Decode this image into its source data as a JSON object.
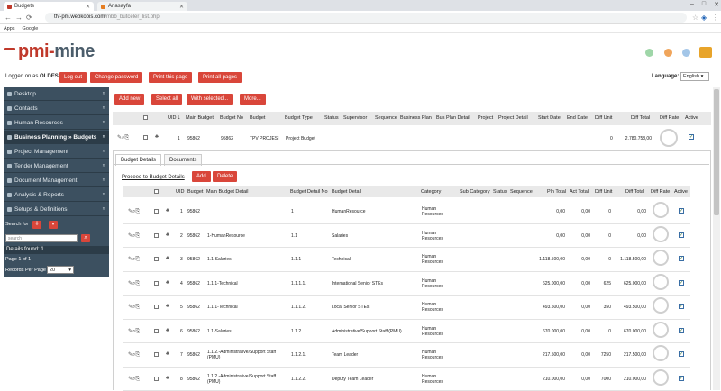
{
  "browser": {
    "tabs": [
      {
        "title": "Budgets",
        "active": true
      },
      {
        "title": "Anasayfa",
        "active": false
      }
    ],
    "address_host": "tfv-pm.webkobis.com",
    "address_path": "/mbb_butceler_list.php",
    "bookmarks": [
      "Apps",
      "Google"
    ]
  },
  "header": {
    "logo_prefix": "pmi-",
    "logo_suffix": "mine",
    "logged_prefix": "Logged on as",
    "logged_user": "OLDES",
    "buttons": [
      "Log out",
      "Change password",
      "Print this page",
      "Print all pages"
    ],
    "language_label": "Language:",
    "language_value": "English"
  },
  "sidebar": {
    "items": [
      {
        "label": "Desktop",
        "active": false
      },
      {
        "label": "Contacts",
        "active": false
      },
      {
        "label": "Human Resources",
        "active": false
      },
      {
        "label": "Business Planning » Budgets",
        "active": true
      },
      {
        "label": "Project Management",
        "active": false
      },
      {
        "label": "Tender Management",
        "active": false
      },
      {
        "label": "Document Management",
        "active": false
      },
      {
        "label": "Analysis & Reports",
        "active": false
      },
      {
        "label": "Setups & Definitions",
        "active": false
      }
    ],
    "search_for": "Search for",
    "search_placeholder": "search",
    "details_found": "Details found",
    "details_count": "1",
    "page_of": "Page 1 of 1",
    "records_per_page": "Records Per Page",
    "records_value": "20"
  },
  "toolbar": {
    "buttons": [
      "Add new",
      "Select all",
      "With selected...",
      "More..."
    ]
  },
  "budget_table": {
    "columns": [
      "UID",
      "Main Budget",
      "Budget No",
      "Budget",
      "Budget Type",
      "Status",
      "Supervisor",
      "Sequence",
      "Business Plan",
      "Bus Plan Detail",
      "Project",
      "Project Detail",
      "Start Date",
      "End Date",
      "Diff Unit",
      "Diff Total",
      "Diff Rate",
      "Active"
    ],
    "row": {
      "uid": "1",
      "main_budget": "95862",
      "budget_no": "95862",
      "budget": "TPV PROJESI",
      "budget_type": "Project Budget",
      "diff_unit": "0",
      "diff_total": "2.780.758,00"
    }
  },
  "detail_tabs": [
    "Budget Details",
    "Documents"
  ],
  "detail_buttons": [
    "Add",
    "Delete"
  ],
  "proceed_link": "Proceed to Budget Details",
  "detail_table": {
    "columns": [
      "UID",
      "Budget",
      "Main Budget Detail",
      "Budget Detail No",
      "Budget Detail",
      "Category",
      "Sub Category",
      "Status",
      "Sequence",
      "Pln Total",
      "Act Total",
      "Diff Unit",
      "Diff Total",
      "Diff Rate",
      "Active"
    ],
    "rows": [
      {
        "uid": "1",
        "budget": "95862",
        "main_detail": "",
        "detail_no": "1",
        "detail": "HumanResource",
        "category": "Human Resources",
        "pln": "0,00",
        "act": "0,00",
        "diff_unit": "0",
        "diff_total": "0,00"
      },
      {
        "uid": "2",
        "budget": "95862",
        "main_detail": "1-HumanResource",
        "detail_no": "1.1",
        "detail": "Salaries",
        "category": "Human Resources",
        "pln": "0,00",
        "act": "0,00",
        "diff_unit": "0",
        "diff_total": "0,00"
      },
      {
        "uid": "3",
        "budget": "95862",
        "main_detail": "1.1-Salaries",
        "detail_no": "1.1.1",
        "detail": "Technical",
        "category": "Human Resources",
        "pln": "1.118.500,00",
        "act": "0,00",
        "diff_unit": "0",
        "diff_total": "1.118.500,00"
      },
      {
        "uid": "4",
        "budget": "95862",
        "main_detail": "1.1.1-Technical",
        "detail_no": "1.1.1.1.",
        "detail": "International Senior STEs",
        "category": "Human Resources",
        "pln": "625.000,00",
        "act": "0,00",
        "diff_unit": "625",
        "diff_total": "625.000,00"
      },
      {
        "uid": "5",
        "budget": "95862",
        "main_detail": "1.1.1-Technical",
        "detail_no": "1.1.1.2.",
        "detail": "Local Senior STEs",
        "category": "Human Resources",
        "pln": "493.500,00",
        "act": "0,00",
        "diff_unit": "350",
        "diff_total": "493.500,00"
      },
      {
        "uid": "6",
        "budget": "95862",
        "main_detail": "1.1-Salaries",
        "detail_no": "1.1.2.",
        "detail": "Administrative/Support Staff (PMU)",
        "category": "Human Resources",
        "pln": "670.000,00",
        "act": "0,00",
        "diff_unit": "0",
        "diff_total": "670.000,00"
      },
      {
        "uid": "7",
        "budget": "95862",
        "main_detail": "1.1.2.-Administrative/Support Staff (PMU)",
        "detail_no": "1.1.2.1.",
        "detail": "Team Leader",
        "category": "Human Resources",
        "pln": "217.500,00",
        "act": "0,00",
        "diff_unit": "7250",
        "diff_total": "217.500,00"
      },
      {
        "uid": "8",
        "budget": "95862",
        "main_detail": "1.1.2.-Administrative/Support Staff (PMU)",
        "detail_no": "1.1.2.2.",
        "detail": "Deputy Team Leader",
        "category": "Human Resources",
        "pln": "210.000,00",
        "act": "0,00",
        "diff_unit": "7000",
        "diff_total": "210.000,00"
      }
    ]
  },
  "colors": {
    "accent": "#d9463a",
    "sidebar": "#3c5060",
    "sidebar_dark": "#2c3c48"
  }
}
